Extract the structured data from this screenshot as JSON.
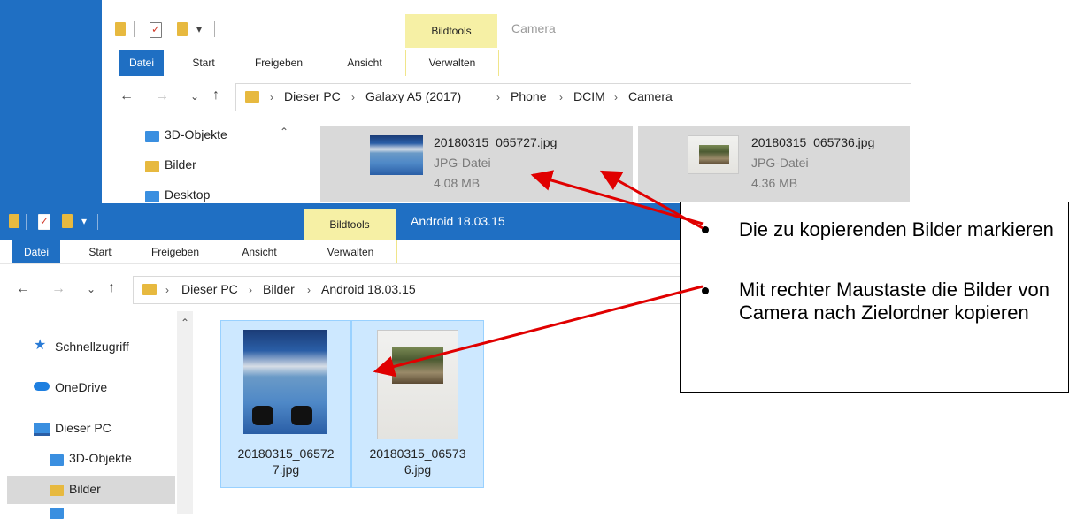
{
  "top_window": {
    "title": "Camera",
    "bildtools": "Bildtools",
    "verwalten": "Verwalten",
    "ribbon_tabs": [
      "Datei",
      "Start",
      "Freigeben",
      "Ansicht"
    ],
    "breadcrumbs": [
      "Dieser PC",
      "Galaxy A5 (2017)",
      "Phone",
      "DCIM",
      "Camera"
    ],
    "tree_items": [
      "3D-Objekte",
      "Bilder",
      "Desktop"
    ],
    "files": [
      {
        "name": "20180315_065727.jpg",
        "type": "JPG-Datei",
        "size": "4.08 MB"
      },
      {
        "name": "20180315_065736.jpg",
        "type": "JPG-Datei",
        "size": "4.36 MB"
      }
    ]
  },
  "bottom_window": {
    "title": "Android 18.03.15",
    "bildtools": "Bildtools",
    "verwalten": "Verwalten",
    "ribbon_tabs": [
      "Datei",
      "Start",
      "Freigeben",
      "Ansicht"
    ],
    "breadcrumbs": [
      "Dieser PC",
      "Bilder",
      "Android 18.03.15"
    ],
    "nav_items": [
      "Schnellzugriff",
      "OneDrive",
      "Dieser PC",
      "3D-Objekte",
      "Bilder"
    ],
    "files": [
      {
        "name_line1": "20180315_06572",
        "name_line2": "7.jpg"
      },
      {
        "name_line1": "20180315_06573",
        "name_line2": "6.jpg"
      }
    ]
  },
  "callout": {
    "bullets": [
      "Die zu kopierenden Bilder markieren",
      "Mit rechter Maustaste die Bilder von Camera nach Zielordner kopieren"
    ]
  },
  "colors": {
    "accent_blue": "#1f6fc3",
    "selection_blue": "#cde8ff",
    "bildtools_yellow": "#f6f0a5",
    "arrow_red": "#e00000"
  },
  "icons": {
    "back": "arrow-left",
    "forward": "arrow-right",
    "history": "chevron-down",
    "up": "arrow-up",
    "star": "star",
    "cloud": "cloud",
    "pc": "computer"
  }
}
